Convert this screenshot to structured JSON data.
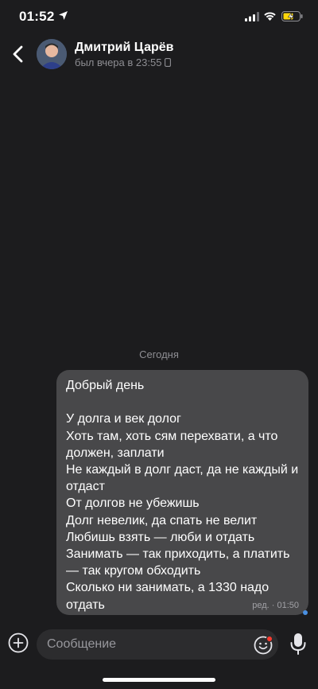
{
  "status_bar": {
    "time": "01:52"
  },
  "header": {
    "contact_name": "Дмитрий Царёв",
    "last_seen": "был вчера в 23:55"
  },
  "chat": {
    "date_separator": "Сегодня",
    "message": {
      "text": "Добрый день\n\nУ долга и век долог\nХоть там, хоть сям перехвати, а что должен, заплати\nНе каждый в долг даст, да не каждый и отдаст\nОт долгов не убежишь\nДолг невелик, да спать не велит\nЛюбишь взять — люби и отдать\nЗанимать — так приходить, а платить — так кругом обходить\nСколько ни занимать, а 1330 надо отдать",
      "meta": "ред. · 01:50"
    }
  },
  "input": {
    "placeholder": "Сообщение"
  },
  "colors": {
    "background": "#1c1c1e",
    "bubble": "#48484a",
    "accent": "#4a90e2",
    "badge": "#ff3b30"
  },
  "icons": [
    "location-arrow-icon",
    "signal-icon",
    "wifi-icon",
    "battery-charging-icon",
    "back-chevron-icon",
    "phone-icon",
    "plus-circle-icon",
    "emoji-icon",
    "mic-icon"
  ]
}
